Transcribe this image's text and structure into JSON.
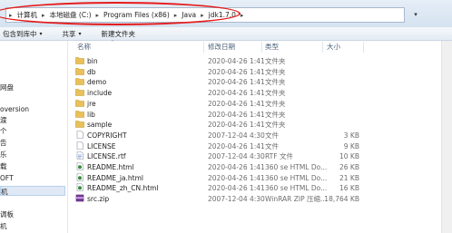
{
  "address": {
    "crumbs": [
      "计算机",
      "本地磁盘 (C:)",
      "Program Files (x86)",
      "Java",
      "jdk1.7.0"
    ],
    "separator": "▸",
    "dropdown": "▾"
  },
  "toolbar": {
    "items": [
      {
        "label": "包含到库中",
        "caret": "▾"
      },
      {
        "label": "共享",
        "caret": "▾"
      },
      {
        "label": "新建文件夹",
        "caret": ""
      }
    ]
  },
  "nav": {
    "items": [
      "网盘",
      "oversion",
      "渡",
      "个",
      "告",
      "乐",
      "载",
      "OFT",
      "机",
      "调板",
      "机"
    ]
  },
  "columns": {
    "name": "名称",
    "date": "修改日期",
    "type": "类型",
    "size": "大小",
    "sort_indicator": "^"
  },
  "files": [
    {
      "name": "bin",
      "date": "2020-04-26 1:41",
      "type": "文件夹",
      "size": "",
      "icon": "folder-icon"
    },
    {
      "name": "db",
      "date": "2020-04-26 1:41",
      "type": "文件夹",
      "size": "",
      "icon": "folder-icon"
    },
    {
      "name": "demo",
      "date": "2020-04-26 1:41",
      "type": "文件夹",
      "size": "",
      "icon": "folder-icon"
    },
    {
      "name": "include",
      "date": "2020-04-26 1:41",
      "type": "文件夹",
      "size": "",
      "icon": "folder-icon"
    },
    {
      "name": "jre",
      "date": "2020-04-26 1:41",
      "type": "文件夹",
      "size": "",
      "icon": "folder-icon"
    },
    {
      "name": "lib",
      "date": "2020-04-26 1:41",
      "type": "文件夹",
      "size": "",
      "icon": "folder-icon"
    },
    {
      "name": "sample",
      "date": "2020-04-26 1:41",
      "type": "文件夹",
      "size": "",
      "icon": "folder-icon"
    },
    {
      "name": "COPYRIGHT",
      "date": "2007-12-04 4:30",
      "type": "文件",
      "size": "3 KB",
      "icon": "file-icon"
    },
    {
      "name": "LICENSE",
      "date": "2020-04-26 1:41",
      "type": "文件",
      "size": "9 KB",
      "icon": "file-icon"
    },
    {
      "name": "LICENSE.rtf",
      "date": "2007-12-04 4:30",
      "type": "RTF 文件",
      "size": "10 KB",
      "icon": "rtf-file-icon"
    },
    {
      "name": "README.html",
      "date": "2020-04-26 1:41",
      "type": "360 se HTML Do...",
      "size": "26 KB",
      "icon": "html-file-icon"
    },
    {
      "name": "README_ja.html",
      "date": "2020-04-26 1:41",
      "type": "360 se HTML Do...",
      "size": "21 KB",
      "icon": "html-file-icon"
    },
    {
      "name": "README_zh_CN.html",
      "date": "2020-04-26 1:41",
      "type": "360 se HTML Do...",
      "size": "16 KB",
      "icon": "html-file-icon"
    },
    {
      "name": "src.zip",
      "date": "2007-12-04 4:30",
      "type": "WinRAR ZIP 压缩...",
      "size": "18,764 KB",
      "icon": "zip-file-icon"
    }
  ],
  "colors": {
    "folder": "#e8c15a",
    "folder_dark": "#c99a2e",
    "highlight": "#e51b1b",
    "selection": "#dfe9f5"
  }
}
